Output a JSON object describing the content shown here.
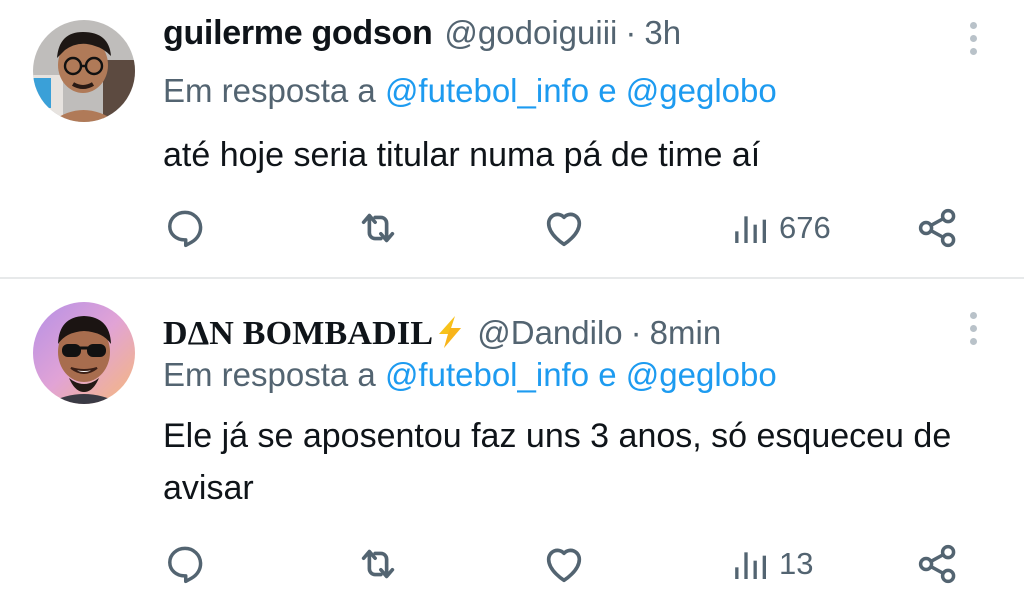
{
  "colors": {
    "text": "#0f1419",
    "secondary": "#536471",
    "mention": "#1d9bf0",
    "divider": "#e7e9ea",
    "bolt": "#f7c21a"
  },
  "tweets": [
    {
      "display_name": "guilerme godson",
      "handle": "@godoiguiii",
      "separator": "·",
      "time": "3h",
      "reply_prefix": "Em resposta a",
      "mention_1": "@futebol_info",
      "reply_joiner": "e",
      "mention_2": "@geglobo",
      "text": "até hoje seria titular numa pá de time aí",
      "views": "676",
      "icons": [
        "reply-icon",
        "retweet-icon",
        "like-icon",
        "views-icon",
        "share-icon",
        "more-icon"
      ]
    },
    {
      "display_name": "DΔN BOMBADIL",
      "name_emoji": "lightning-bolt-icon",
      "handle": "@Dandilo",
      "separator": "·",
      "time": "8min",
      "reply_prefix": "Em resposta a",
      "mention_1": "@futebol_info",
      "reply_joiner": "e",
      "mention_2": "@geglobo",
      "text": "Ele já se aposentou faz uns 3 anos, só esqueceu de avisar",
      "views": "13",
      "icons": [
        "reply-icon",
        "retweet-icon",
        "like-icon",
        "views-icon",
        "share-icon",
        "more-icon"
      ]
    }
  ]
}
